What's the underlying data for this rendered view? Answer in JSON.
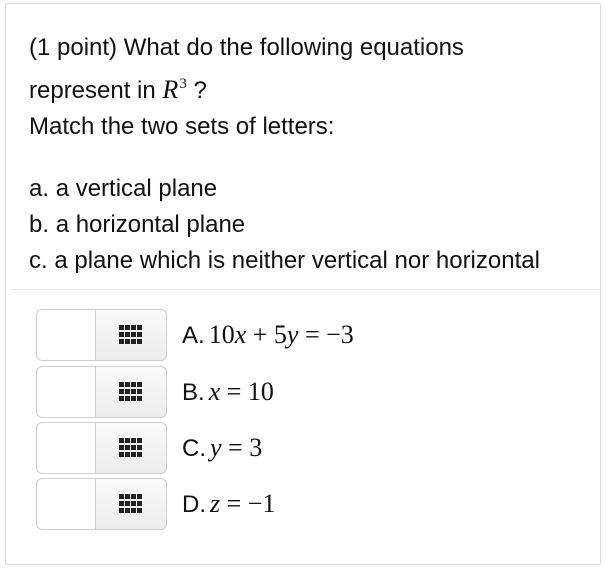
{
  "question": {
    "line1": "(1 point) What do the following equations",
    "line2_prefix": "represent in",
    "space_symbol": "R",
    "space_exponent": "3",
    "line2_suffix": " ?",
    "match_prompt": "Match the two sets of letters:"
  },
  "options": [
    {
      "letter": "a.",
      "text": "a vertical plane"
    },
    {
      "letter": "b.",
      "text": "a horizontal plane"
    },
    {
      "letter": "c.",
      "text": "a plane which is neither vertical nor horizontal"
    }
  ],
  "equations": [
    {
      "label": "A.",
      "answer": "",
      "equation_html": "10<i>x</i> + 5<i>y</i> = −3"
    },
    {
      "label": "B.",
      "answer": "",
      "equation_html": "<i>x</i> = 10"
    },
    {
      "label": "C.",
      "answer": "",
      "equation_html": "<i>y</i> = 3"
    },
    {
      "label": "D.",
      "answer": "",
      "equation_html": "<i>z</i> = −1"
    }
  ],
  "icons": {
    "select_button_icon": "grid-icon"
  }
}
